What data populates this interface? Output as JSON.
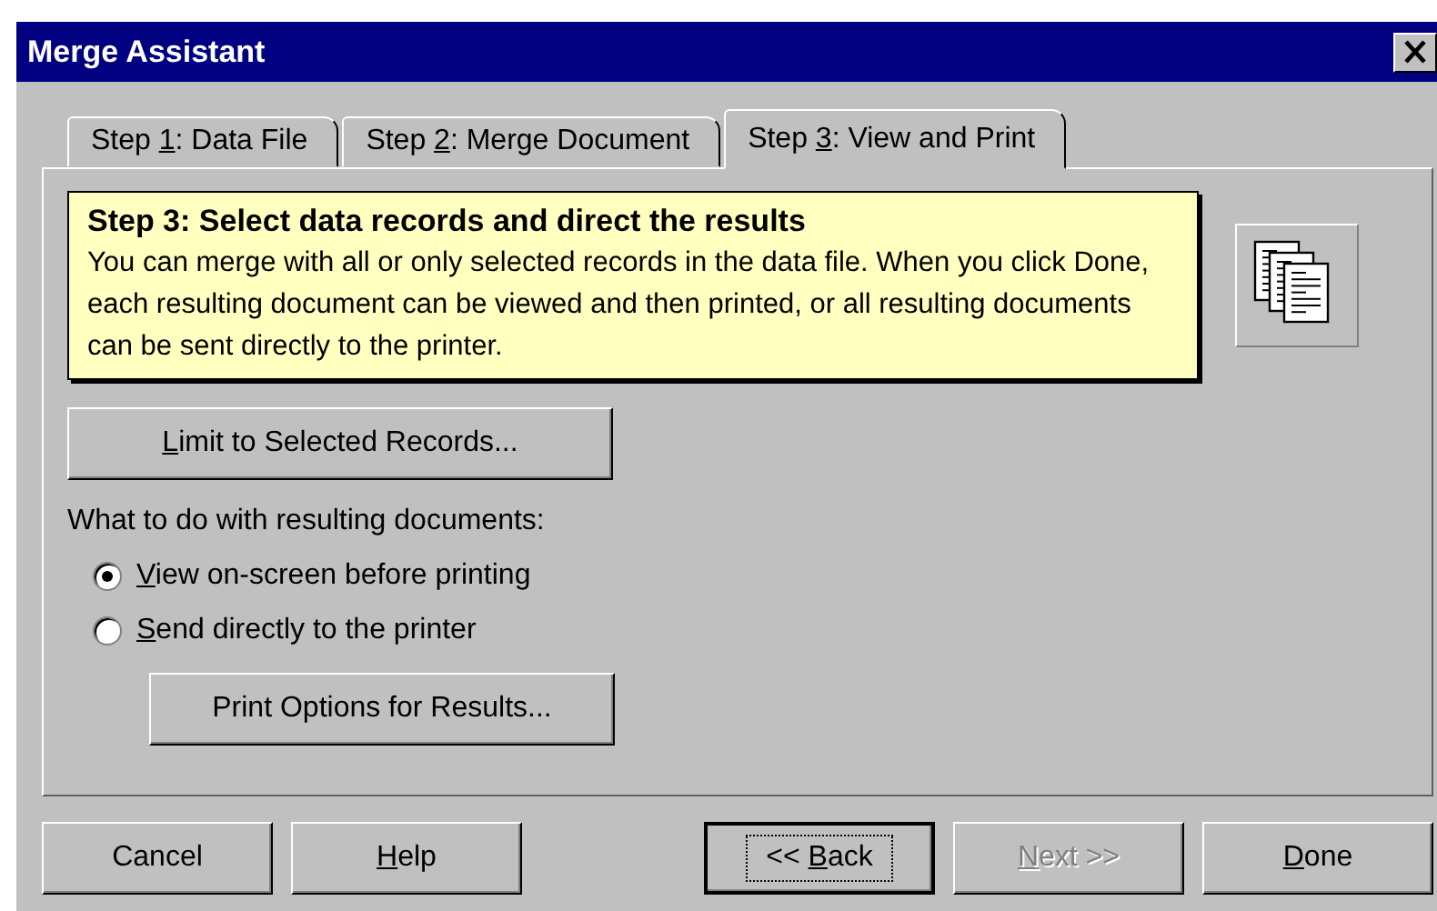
{
  "window": {
    "title": "Merge Assistant"
  },
  "tabs": [
    {
      "pre": "Step ",
      "key": "1",
      "post": ":  Data File",
      "selected": false
    },
    {
      "pre": "Step ",
      "key": "2",
      "post": ":  Merge Document",
      "selected": false
    },
    {
      "pre": "Step ",
      "key": "3",
      "post": ":  View and Print",
      "selected": true
    }
  ],
  "header": {
    "title": "Step 3:  Select data records and direct the results",
    "body": "You can merge with all or only selected records in the data file. When you click Done, each resulting document can be viewed and then printed, or all resulting documents can be sent directly to the printer."
  },
  "limit_button": {
    "key": "L",
    "post": "imit to Selected Records..."
  },
  "group_label": "What to do with resulting documents:",
  "options": [
    {
      "key": "V",
      "post": "iew on-screen before printing",
      "selected": true
    },
    {
      "key": "S",
      "post": "end directly to the printer",
      "selected": false
    }
  ],
  "print_options_button": {
    "pre": "Print Options for Results..."
  },
  "buttons": [
    {
      "pre": "Cancel",
      "disabled": false,
      "focused": false
    },
    {
      "key": "H",
      "post": "elp",
      "disabled": false,
      "focused": false
    },
    {
      "pre": "<< ",
      "key": "B",
      "post": "ack",
      "disabled": false,
      "focused": true
    },
    {
      "key": "N",
      "post": "ext >>",
      "disabled": true,
      "focused": false
    },
    {
      "key": "D",
      "post": "one",
      "disabled": false,
      "focused": false
    }
  ]
}
